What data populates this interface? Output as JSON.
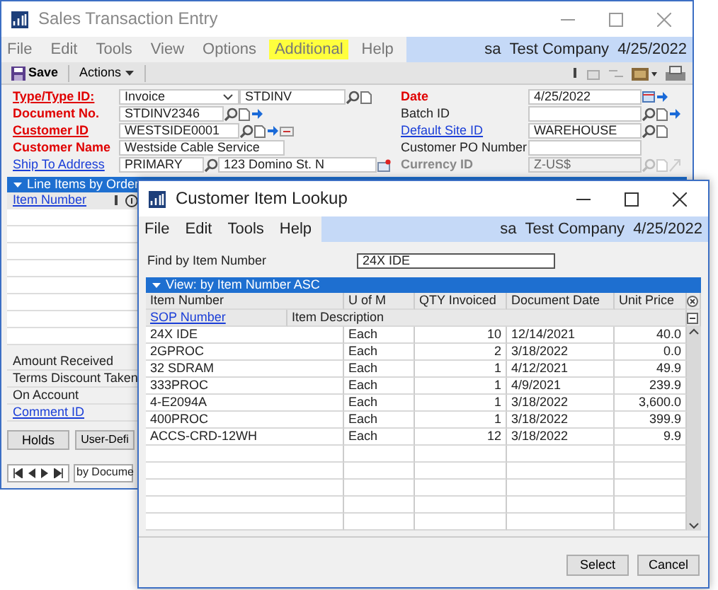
{
  "main_window": {
    "title": "Sales Transaction Entry",
    "menu": [
      {
        "label": "File",
        "highlighted": false
      },
      {
        "label": "Edit",
        "highlighted": false
      },
      {
        "label": "Tools",
        "highlighted": false
      },
      {
        "label": "View",
        "highlighted": false
      },
      {
        "label": "Options",
        "highlighted": false
      },
      {
        "label": "Additional",
        "highlighted": true
      },
      {
        "label": "Help",
        "highlighted": false
      }
    ],
    "user_info": {
      "user": "sa",
      "company": "Test Company",
      "date": "4/25/2022"
    },
    "toolbar": {
      "save": "Save",
      "actions": "Actions"
    },
    "form_left": [
      {
        "label": "Type/Type ID:",
        "kind": "required_link",
        "fields": [
          {
            "kind": "combo",
            "value": "Invoice"
          },
          {
            "kind": "text",
            "value": "STDINV"
          }
        ]
      },
      {
        "label": "Document No.",
        "kind": "required",
        "fields": [
          {
            "kind": "text",
            "value": "STDINV2346"
          }
        ]
      },
      {
        "label": "Customer ID",
        "kind": "required_link",
        "fields": [
          {
            "kind": "text",
            "value": "WESTSIDE0001"
          }
        ]
      },
      {
        "label": "Customer Name",
        "kind": "required",
        "fields": [
          {
            "kind": "text",
            "value": "Westside Cable Service"
          }
        ]
      },
      {
        "label": "Ship To Address",
        "kind": "link",
        "fields": [
          {
            "kind": "text",
            "value": "PRIMARY"
          },
          {
            "kind": "text",
            "value": "123 Domino St. N"
          }
        ]
      }
    ],
    "form_right": [
      {
        "label": "Date",
        "kind": "required",
        "fields": [
          {
            "kind": "text",
            "value": "4/25/2022"
          }
        ]
      },
      {
        "label": "Batch ID",
        "kind": "plain",
        "fields": [
          {
            "kind": "text"
          }
        ]
      },
      {
        "label": "Default Site ID",
        "kind": "link",
        "fields": [
          {
            "kind": "text",
            "value": "WAREHOUSE"
          }
        ]
      },
      {
        "label": "Customer PO Number",
        "kind": "plain",
        "fields": [
          {
            "kind": "text"
          }
        ]
      },
      {
        "label": "Currency ID",
        "kind": "disabled",
        "fields": [
          {
            "kind": "text",
            "value": "Z-US$"
          }
        ]
      }
    ],
    "line_items": {
      "title": "Line Items by Order",
      "column": "Item Number"
    },
    "totals": [
      {
        "label": "Amount Received",
        "kind": "plain"
      },
      {
        "label": "Terms Discount Taken",
        "kind": "plain"
      },
      {
        "label": "On Account",
        "kind": "plain"
      },
      {
        "label": "Comment ID",
        "kind": "link"
      }
    ],
    "buttons": [
      "Holds",
      "User-Defi"
    ],
    "sort": "by Docume"
  },
  "dialog": {
    "title": "Customer Item Lookup",
    "menu": [
      "File",
      "Edit",
      "Tools",
      "Help"
    ],
    "user_info": {
      "user": "sa",
      "company": "Test Company",
      "date": "4/25/2022"
    },
    "find": {
      "label": "Find by Item Number",
      "value": "24X IDE"
    },
    "view": "View: by Item Number ASC",
    "columns": [
      "Item Number",
      "U of M",
      "QTY Invoiced",
      "Document Date",
      "Unit Price"
    ],
    "sub_columns": [
      {
        "label": "SOP Number",
        "kind": "link"
      },
      {
        "label": "Item Description",
        "kind": "plain"
      }
    ],
    "rows": [
      [
        "24X IDE",
        "Each",
        "10",
        "12/14/2021",
        "40.0"
      ],
      [
        "2GPROC",
        "Each",
        "2",
        "3/18/2022",
        "0.0"
      ],
      [
        "32 SDRAM",
        "Each",
        "1",
        "4/12/2021",
        "49.9"
      ],
      [
        "333PROC",
        "Each",
        "1",
        "4/9/2021",
        "239.9"
      ],
      [
        "4-E2094A",
        "Each",
        "1",
        "3/18/2022",
        "3,600.0"
      ],
      [
        "400PROC",
        "Each",
        "1",
        "3/18/2022",
        "399.9"
      ],
      [
        "ACCS-CRD-12WH",
        "Each",
        "12",
        "3/18/2022",
        "9.9"
      ]
    ],
    "buttons": [
      "Select",
      "Cancel"
    ]
  }
}
